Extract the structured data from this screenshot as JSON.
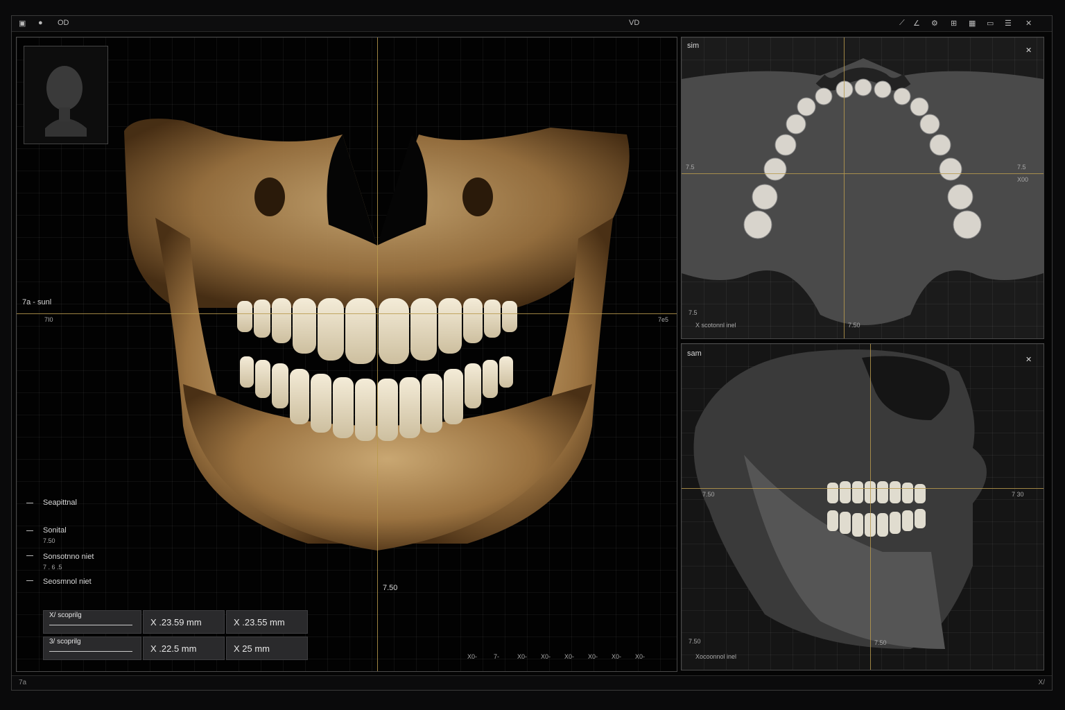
{
  "topbar": {
    "left_icons": [
      "camera-icon",
      "record-icon"
    ],
    "left_label": "OD",
    "center_label": "VD",
    "right_icons": [
      "ruler-icon",
      "angle-icon",
      "gear-icon",
      "grid-icon",
      "layout-icon",
      "window-icon",
      "menu-icon",
      "close-icon"
    ]
  },
  "main_view": {
    "left_axis_label": "7a - sunl",
    "left_axis_sub": "7I0",
    "right_axis_label": "7e5",
    "center_readout": "7.50",
    "planes": [
      {
        "label": "Seapittnal",
        "sub": ""
      },
      {
        "label": "Sonital",
        "sub": "7.50"
      },
      {
        "label": "Sonsotnno niet",
        "sub": "7 . 6 .5"
      },
      {
        "label": "Seosmnol niet",
        "sub": ""
      }
    ],
    "measurements": [
      {
        "label": "X/ scoprilg",
        "value1": "X .23.59 mm",
        "value2": "X .23.55 mm"
      },
      {
        "label": "3/ scoprilg",
        "value1": "X .22.5 mm",
        "value2": "X 25 mm"
      }
    ],
    "bottom_ticks": [
      "X0-",
      "7-",
      "X0-",
      "X0-",
      "X0-",
      "X0-",
      "X0-",
      "X0-"
    ]
  },
  "axial_view": {
    "title": "sim",
    "left_label": "7.5",
    "right_label": "7.5",
    "right_sub": "X00",
    "bottom_left": "7.5",
    "bottom_left_2": "X scotonnl inel",
    "bottom_readout": "7.50"
  },
  "sagittal_view": {
    "title": "sam",
    "left_label": "7.50",
    "right_label": "7 30",
    "bottom_readout": "7.50",
    "bottom_left": "7.50",
    "bottom_left_2": "Xocoonnol inel"
  },
  "statusbar": {
    "left": "7a",
    "right": "X/"
  }
}
